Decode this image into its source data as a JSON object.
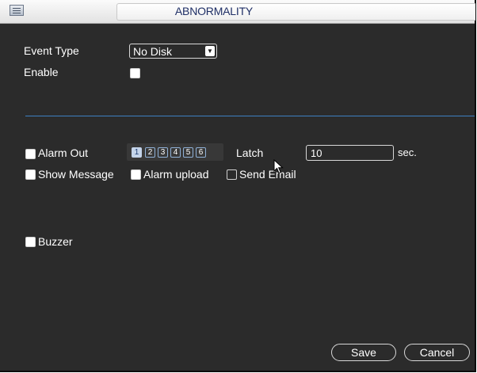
{
  "window": {
    "title": "ABNORMALITY",
    "title_color": "#1f2f66"
  },
  "titlebar": {
    "icon": "menu-list-icon"
  },
  "event_type": {
    "label": "Event Type",
    "value": "No Disk",
    "arrow_icon": "dropdown-arrow-icon"
  },
  "enable": {
    "label": "Enable",
    "checked": false
  },
  "separator_color": "#3d7fc3",
  "alarm_out": {
    "label": "Alarm Out",
    "checked": false,
    "channels": [
      "1",
      "2",
      "3",
      "4",
      "5",
      "6"
    ],
    "selected_channel": "1"
  },
  "latch": {
    "label": "Latch",
    "value": "10",
    "unit": "sec."
  },
  "show_message": {
    "label": "Show Message",
    "checked": false
  },
  "alarm_upload": {
    "label": "Alarm upload",
    "checked": false
  },
  "send_email": {
    "label": "Send Email",
    "checked": false
  },
  "buzzer": {
    "label": "Buzzer",
    "checked": false
  },
  "buttons": {
    "save": "Save",
    "cancel": "Cancel"
  },
  "cursor_icon": "mouse-pointer-icon"
}
